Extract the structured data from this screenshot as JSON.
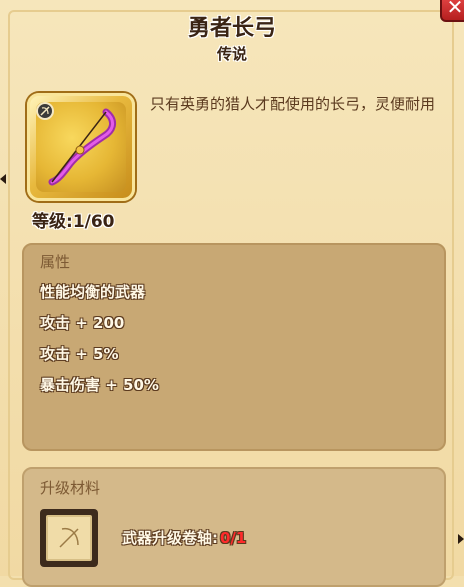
{
  "header": {
    "title": "勇者长弓",
    "rarity": "传说"
  },
  "item": {
    "description": "只有英勇的猎人才配使用的长弓，灵便耐用",
    "level_label": "等级:",
    "level_value": "1/60",
    "icon": "bow-icon",
    "weapon_type_icon": "bow-type-badge-icon"
  },
  "attributes": {
    "title": "属性",
    "lines": [
      "性能均衡的武器",
      "攻击 + 200",
      "攻击 + 5%",
      "暴击伤害 + 50%"
    ]
  },
  "upgrade": {
    "title": "升级材料",
    "material_label": "武器升级卷轴:",
    "material_count": "0/1",
    "material_icon": "scroll-icon"
  },
  "colors": {
    "background": "#f3dfae",
    "panel": "#c8a874",
    "accent_gold": "#e6b735",
    "shortage_red": "#ff2b2b",
    "close_red": "#d83030"
  }
}
